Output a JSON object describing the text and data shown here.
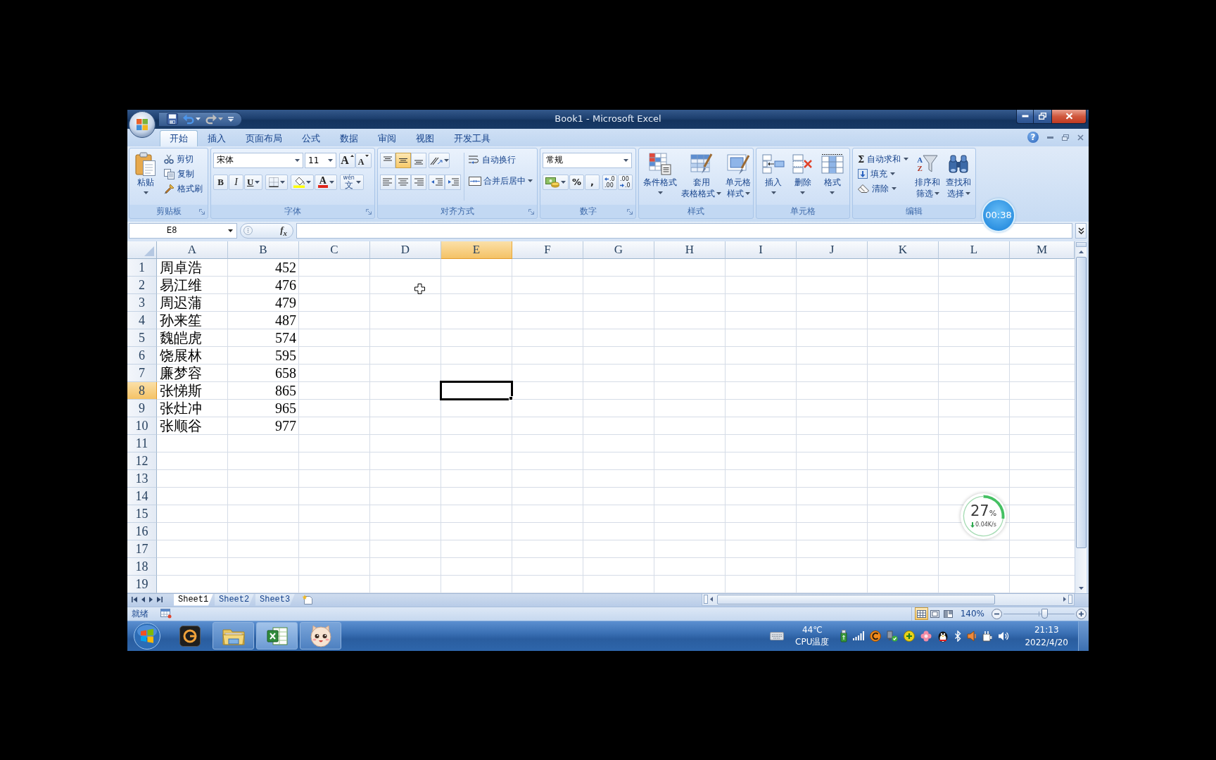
{
  "window": {
    "title": "Book1 - Microsoft Excel"
  },
  "quick_access": [
    {
      "kind": "save",
      "disabled": false
    },
    {
      "kind": "undo",
      "disabled": false
    },
    {
      "kind": "redo",
      "disabled": true
    },
    {
      "kind": "customize",
      "disabled": false
    }
  ],
  "tabs": [
    {
      "label": "开始",
      "selected": true
    },
    {
      "label": "插入",
      "selected": false
    },
    {
      "label": "页面布局",
      "selected": false
    },
    {
      "label": "公式",
      "selected": false
    },
    {
      "label": "数据",
      "selected": false
    },
    {
      "label": "审阅",
      "selected": false
    },
    {
      "label": "视图",
      "selected": false
    },
    {
      "label": "开发工具",
      "selected": false
    }
  ],
  "workbook_controls": {
    "help": "?"
  },
  "ribbon": [
    {
      "kind": "clipboard",
      "label": "剪贴板",
      "launcher": true,
      "paste": "粘贴",
      "items": [
        {
          "kind": "cut",
          "label": "剪切"
        },
        {
          "kind": "copy",
          "label": "复制"
        },
        {
          "kind": "format_painter",
          "label": "格式刷"
        }
      ]
    },
    {
      "kind": "font",
      "label": "字体",
      "launcher": true,
      "font_name": "宋体",
      "font_size": "11",
      "grow_font": "A",
      "shrink_font": "A",
      "styles": [
        {
          "kind": "bold",
          "glyph": "B"
        },
        {
          "kind": "italic",
          "glyph": "I"
        },
        {
          "kind": "underline",
          "glyph": "U"
        }
      ],
      "font_color": "A",
      "phonetic": {
        "top": "wén",
        "main": "文"
      }
    },
    {
      "kind": "alignment",
      "label": "对齐方式",
      "launcher": true,
      "vertical": [
        {
          "kind": "top",
          "selected": false
        },
        {
          "kind": "middle",
          "selected": true
        },
        {
          "kind": "bottom",
          "selected": false
        }
      ],
      "horizontal": [
        {
          "kind": "left",
          "selected": false
        },
        {
          "kind": "center",
          "selected": false
        },
        {
          "kind": "right",
          "selected": false
        }
      ],
      "wrap_text": "自动换行",
      "merge_center": "合并后居中"
    },
    {
      "kind": "number",
      "label": "数字",
      "launcher": true,
      "format": "常规",
      "percent": "%",
      "comma": ",",
      "increase_decimal": {
        "top": ".0",
        "bottom": ".00"
      },
      "decrease_decimal": {
        "top": ".00",
        "bottom": ".0"
      }
    },
    {
      "kind": "styles",
      "label": "样式",
      "launcher": false,
      "buttons": [
        {
          "kind": "conditional",
          "lines": [
            "条件格式"
          ]
        },
        {
          "kind": "table",
          "lines": [
            "套用",
            "表格格式"
          ]
        },
        {
          "kind": "cell_styles",
          "lines": [
            "单元格",
            "样式"
          ]
        }
      ]
    },
    {
      "kind": "cells",
      "label": "单元格",
      "launcher": false,
      "buttons": [
        {
          "kind": "insert",
          "lines": [
            "插入"
          ]
        },
        {
          "kind": "delete",
          "lines": [
            "删除"
          ]
        },
        {
          "kind": "format",
          "lines": [
            "格式"
          ]
        }
      ]
    },
    {
      "kind": "editing",
      "label": "编辑",
      "launcher": false,
      "items": [
        {
          "kind": "autosum",
          "glyph": "Σ",
          "label": "自动求和"
        },
        {
          "kind": "fill",
          "label": "填充"
        },
        {
          "kind": "clear",
          "label": "清除"
        }
      ],
      "buttons": [
        {
          "kind": "sort_filter",
          "glyphs": [
            "A",
            "Z"
          ],
          "lines": [
            "排序和",
            "筛选"
          ]
        },
        {
          "kind": "find_select",
          "lines": [
            "查找和",
            "选择"
          ]
        }
      ]
    }
  ],
  "formula_bar": {
    "name_box": "E8",
    "insert_function": "f$_{x}$"
  },
  "recording_timer": {
    "time": "00:38"
  },
  "sheet": {
    "columns": [
      {
        "label": "A",
        "selected": false
      },
      {
        "label": "B",
        "selected": false
      },
      {
        "label": "C",
        "selected": false
      },
      {
        "label": "D",
        "selected": false
      },
      {
        "label": "E",
        "selected": true
      },
      {
        "label": "F",
        "selected": false
      },
      {
        "label": "G",
        "selected": false
      },
      {
        "label": "H",
        "selected": false
      },
      {
        "label": "I",
        "selected": false
      },
      {
        "label": "J",
        "selected": false
      },
      {
        "label": "K",
        "selected": false
      },
      {
        "label": "L",
        "selected": false
      },
      {
        "label": "M",
        "selected": false
      }
    ],
    "rows": [
      {
        "label": "1",
        "selected": false,
        "cells": [
          {
            "kind": "text",
            "value": "周卓浩"
          },
          {
            "kind": "number",
            "value": "452"
          }
        ]
      },
      {
        "label": "2",
        "selected": false,
        "cells": [
          {
            "kind": "text",
            "value": "易江维"
          },
          {
            "kind": "number",
            "value": "476"
          }
        ]
      },
      {
        "label": "3",
        "selected": false,
        "cells": [
          {
            "kind": "text",
            "value": "周迟蒲"
          },
          {
            "kind": "number",
            "value": "479"
          }
        ]
      },
      {
        "label": "4",
        "selected": false,
        "cells": [
          {
            "kind": "text",
            "value": "孙来笙"
          },
          {
            "kind": "number",
            "value": "487"
          }
        ]
      },
      {
        "label": "5",
        "selected": false,
        "cells": [
          {
            "kind": "text",
            "value": "魏皑虎"
          },
          {
            "kind": "number",
            "value": "574"
          }
        ]
      },
      {
        "label": "6",
        "selected": false,
        "cells": [
          {
            "kind": "text",
            "value": "饶展林"
          },
          {
            "kind": "number",
            "value": "595"
          }
        ]
      },
      {
        "label": "7",
        "selected": false,
        "cells": [
          {
            "kind": "text",
            "value": "廉梦容"
          },
          {
            "kind": "number",
            "value": "658"
          }
        ]
      },
      {
        "label": "8",
        "selected": true,
        "cells": [
          {
            "kind": "text",
            "value": "张悌斯"
          },
          {
            "kind": "number",
            "value": "865"
          }
        ]
      },
      {
        "label": "9",
        "selected": false,
        "cells": [
          {
            "kind": "text",
            "value": "张灶冲"
          },
          {
            "kind": "number",
            "value": "965"
          }
        ]
      },
      {
        "label": "10",
        "selected": false,
        "cells": [
          {
            "kind": "text",
            "value": "张顺谷"
          },
          {
            "kind": "number",
            "value": "977"
          }
        ]
      },
      {
        "label": "11",
        "selected": false
      },
      {
        "label": "12",
        "selected": false
      },
      {
        "label": "13",
        "selected": false
      },
      {
        "label": "14",
        "selected": false
      },
      {
        "label": "15",
        "selected": false
      },
      {
        "label": "16",
        "selected": false
      },
      {
        "label": "17",
        "selected": false
      },
      {
        "label": "18",
        "selected": false
      },
      {
        "label": "19",
        "selected": false
      }
    ]
  },
  "network_widget": {
    "value": "27",
    "unit": "%",
    "speed": "0.04K/s",
    "chart_data": {
      "type": "donut",
      "values": [
        27,
        73
      ],
      "colors": [
        "#45c063",
        "#a6dcb4"
      ]
    }
  },
  "sheet_tabs": [
    {
      "label": "Sheet1",
      "selected": true
    },
    {
      "label": "Sheet2",
      "selected": false
    },
    {
      "label": "Sheet3",
      "selected": false
    }
  ],
  "status_bar": {
    "status": "就绪",
    "views": [
      {
        "kind": "normal",
        "selected": true
      },
      {
        "kind": "page_layout",
        "selected": false
      },
      {
        "kind": "page_break",
        "selected": false
      }
    ],
    "zoom": "140%",
    "zoom_slider": {
      "level": 0.57
    }
  },
  "taskbar": {
    "apps": [
      {
        "kind": "g_app",
        "running": false,
        "selected": false
      },
      {
        "kind": "folder",
        "running": true,
        "selected": false
      },
      {
        "kind": "spreadsheet",
        "running": true,
        "selected": true
      },
      {
        "kind": "cat",
        "running": true,
        "selected": false
      }
    ],
    "tray": [
      {
        "kind": "keyboard"
      },
      {
        "kind": "temperature",
        "value": "44℃",
        "label": "CPU温度"
      },
      {
        "kind": "usb"
      },
      {
        "kind": "signal"
      },
      {
        "kind": "ring"
      },
      {
        "kind": "network"
      },
      {
        "kind": "plus"
      },
      {
        "kind": "flower"
      },
      {
        "kind": "penguin"
      },
      {
        "kind": "bluetooth"
      },
      {
        "kind": "speaker"
      },
      {
        "kind": "plug"
      },
      {
        "kind": "volume"
      }
    ],
    "clock": {
      "time": "21:13",
      "date": "2022/4/20"
    }
  }
}
